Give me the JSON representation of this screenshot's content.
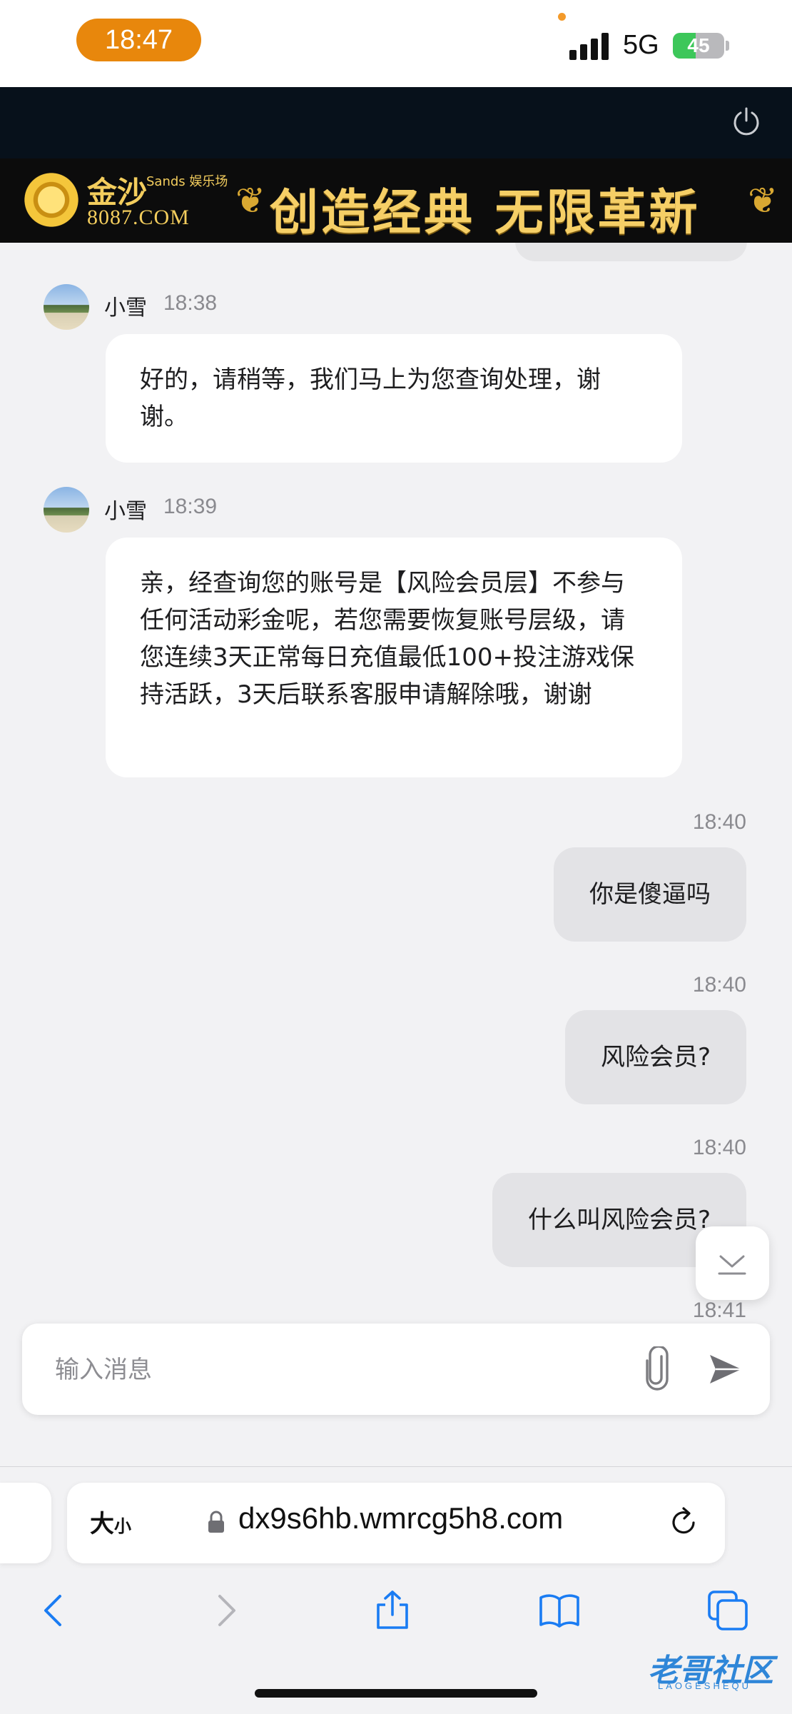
{
  "status_bar": {
    "time": "18:47",
    "network": "5G",
    "battery": "45",
    "battery_level": 0.45,
    "time_pill_color": "#e8870c"
  },
  "banner": {
    "brand_name": "金沙",
    "brand_sub": "Sands 娱乐场",
    "brand_domain": "8087.COM",
    "slogan": "创造经典 无限革新"
  },
  "chat": {
    "messages": [
      {
        "direction": "in",
        "sender": "小雪",
        "time": "18:38",
        "text": "好的，请稍等，我们马上为您查询处理，谢谢。"
      },
      {
        "direction": "in",
        "sender": "小雪",
        "time": "18:39",
        "text": "亲，经查询您的账号是【风险会员层】不参与任何活动彩金呢，若您需要恢复账号层级，请您连续3天正常每日充值最低100+投注游戏保持活跃，3天后联系客服申请解除哦，谢谢"
      },
      {
        "direction": "out",
        "time": "18:40",
        "text": "你是傻逼吗"
      },
      {
        "direction": "out",
        "time": "18:40",
        "text": "风险会员?"
      },
      {
        "direction": "out",
        "time": "18:40",
        "text": "什么叫风险会员?"
      },
      {
        "direction": "out",
        "time": "18:41",
        "text": ""
      }
    ]
  },
  "composer": {
    "placeholder": "输入消息"
  },
  "browser": {
    "text_size_label": "大",
    "text_size_small": "小",
    "url": "dx9s6hb.wmrcg5h8.com"
  },
  "watermark": {
    "text": "老哥社区",
    "latin": "LAOGESHEQU"
  }
}
